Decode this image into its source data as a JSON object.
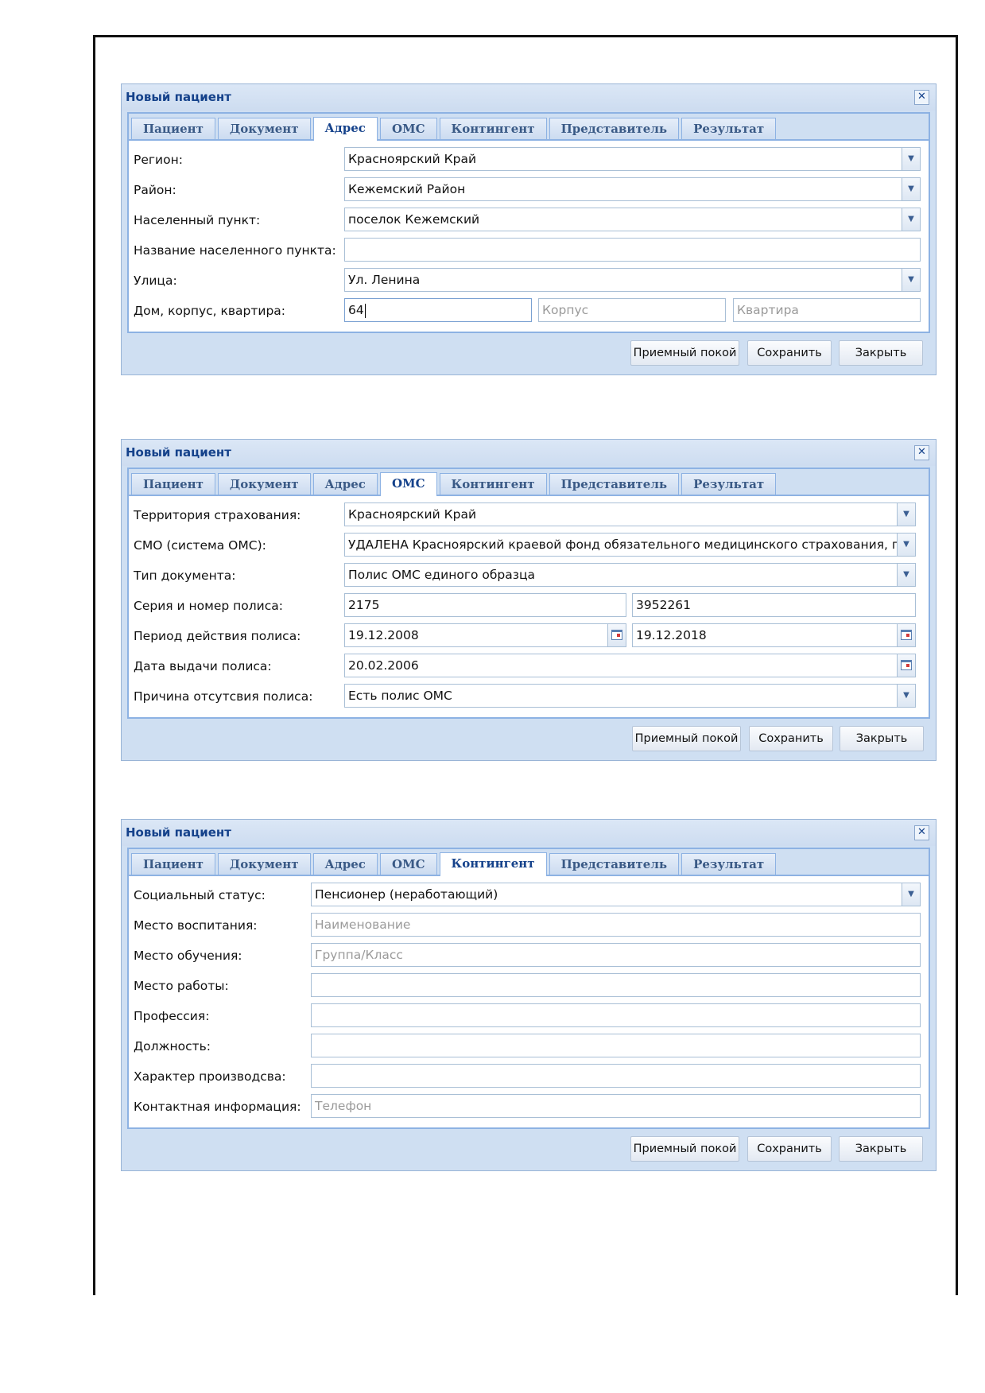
{
  "tabs": [
    "Пациент",
    "Документ",
    "Адрес",
    "ОМС",
    "Контингент",
    "Представитель",
    "Результат"
  ],
  "buttons": {
    "reception": "Приемный покой",
    "save": "Сохранить",
    "close": "Закрыть"
  },
  "windows": [
    {
      "title": "Новый пациент",
      "active_tab": "Адрес",
      "fields": [
        {
          "label": "Регион:",
          "value": "Красноярский Край",
          "type": "combo"
        },
        {
          "label": "Район:",
          "value": "Кежемский Район",
          "type": "combo"
        },
        {
          "label": "Населенный пункт:",
          "value": "поселок Кежемский",
          "type": "combo"
        },
        {
          "label": "Название населенного пункта:",
          "value": "",
          "type": "text"
        },
        {
          "label": "Улица:",
          "value": "Ул. Ленина",
          "type": "combo"
        },
        {
          "label": "Дом, корпус, квартира:",
          "house": "64",
          "korpus_placeholder": "Корпус",
          "apartment_placeholder": "Квартира"
        }
      ]
    },
    {
      "title": "Новый пациент",
      "active_tab": "ОМС",
      "fields": [
        {
          "label": "Территория страхования:",
          "value": "Красноярский Край",
          "type": "combo"
        },
        {
          "label": "СМО (система ОМС):",
          "value": "УДАЛЕНА Красноярский краевой фонд обязательного медицинского страхования, пр",
          "type": "combo"
        },
        {
          "label": "Тип документа:",
          "value": "Полис ОМС единого образца",
          "type": "combo"
        },
        {
          "label": "Серия и номер полиса:",
          "series": "2175",
          "number": "3952261"
        },
        {
          "label": "Период действия полиса:",
          "from": "19.12.2008",
          "to": "19.12.2018"
        },
        {
          "label": "Дата выдачи полиса:",
          "value": "20.02.2006",
          "type": "date"
        },
        {
          "label": "Причина отсутсвия полиса:",
          "value": "Есть полис ОМС",
          "type": "combo"
        }
      ]
    },
    {
      "title": "Новый пациент",
      "active_tab": "Контингент",
      "fields": [
        {
          "label": "Социальный статус:",
          "value": "Пенсионер (неработающий)",
          "type": "combo"
        },
        {
          "label": "Место воспитания:",
          "value": "",
          "placeholder": "Наименование",
          "type": "text"
        },
        {
          "label": "Место обучения:",
          "value": "",
          "placeholder": "Группа/Класс",
          "type": "text"
        },
        {
          "label": "Место работы:",
          "value": "",
          "type": "text"
        },
        {
          "label": "Профессия:",
          "value": "",
          "type": "text"
        },
        {
          "label": "Должность:",
          "value": "",
          "type": "text"
        },
        {
          "label": "Характер производсва:",
          "value": "",
          "type": "text"
        },
        {
          "label": "Контактная информация:",
          "value": "",
          "placeholder": "Телефон",
          "type": "text"
        }
      ]
    }
  ]
}
